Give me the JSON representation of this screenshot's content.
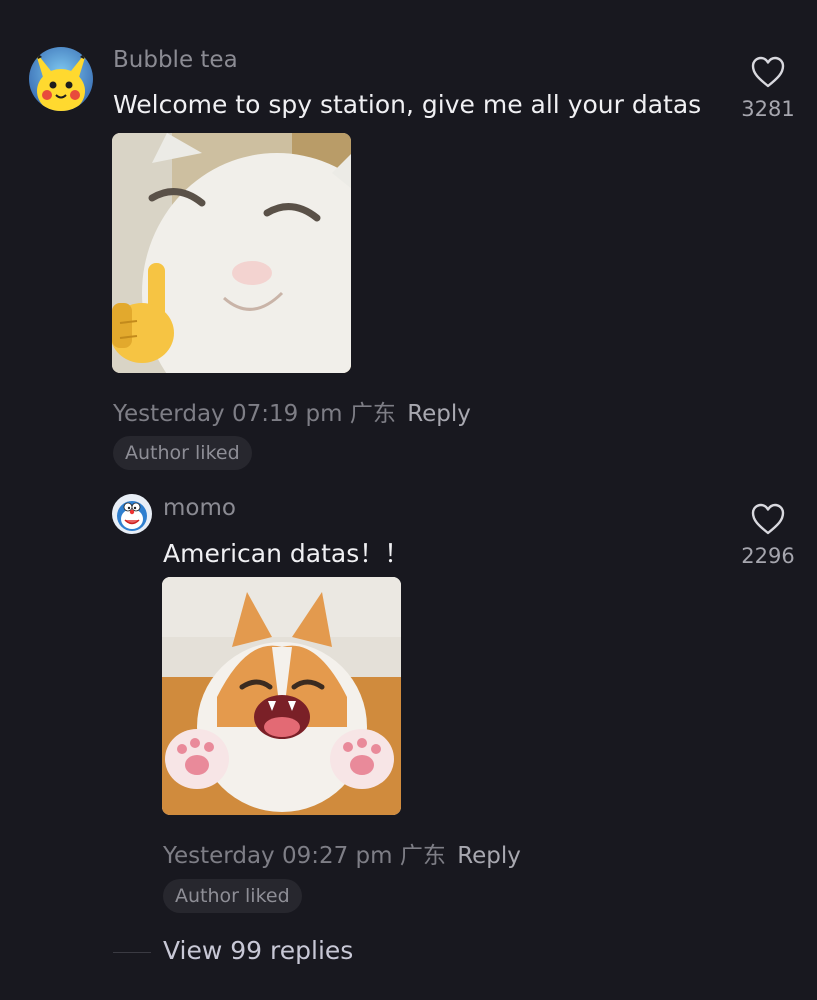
{
  "comments": [
    {
      "username": "Bubble tea",
      "text": "Welcome to spy station, give me all your datas",
      "timestamp": "Yesterday 07:19 pm",
      "location": "广东",
      "reply_label": "Reply",
      "badge": "Author liked",
      "like_count": "3281",
      "avatar_icon": "pikachu-avatar-icon",
      "sticker": "cat-sticker-icon"
    }
  ],
  "replies": [
    {
      "username": "momo",
      "text": "American datas！！",
      "timestamp": "Yesterday 09:27 pm",
      "location": "广东",
      "reply_label": "Reply",
      "badge": "Author liked",
      "like_count": "2296",
      "avatar_icon": "doraemon-avatar-icon",
      "sticker": "laughing-cat-sticker-icon"
    }
  ],
  "view_replies_label": "View 99 replies",
  "colors": {
    "background": "#18181f",
    "text_primary": "#f0f0f3",
    "text_secondary": "#8b8b93",
    "badge_bg": "#27272e"
  }
}
